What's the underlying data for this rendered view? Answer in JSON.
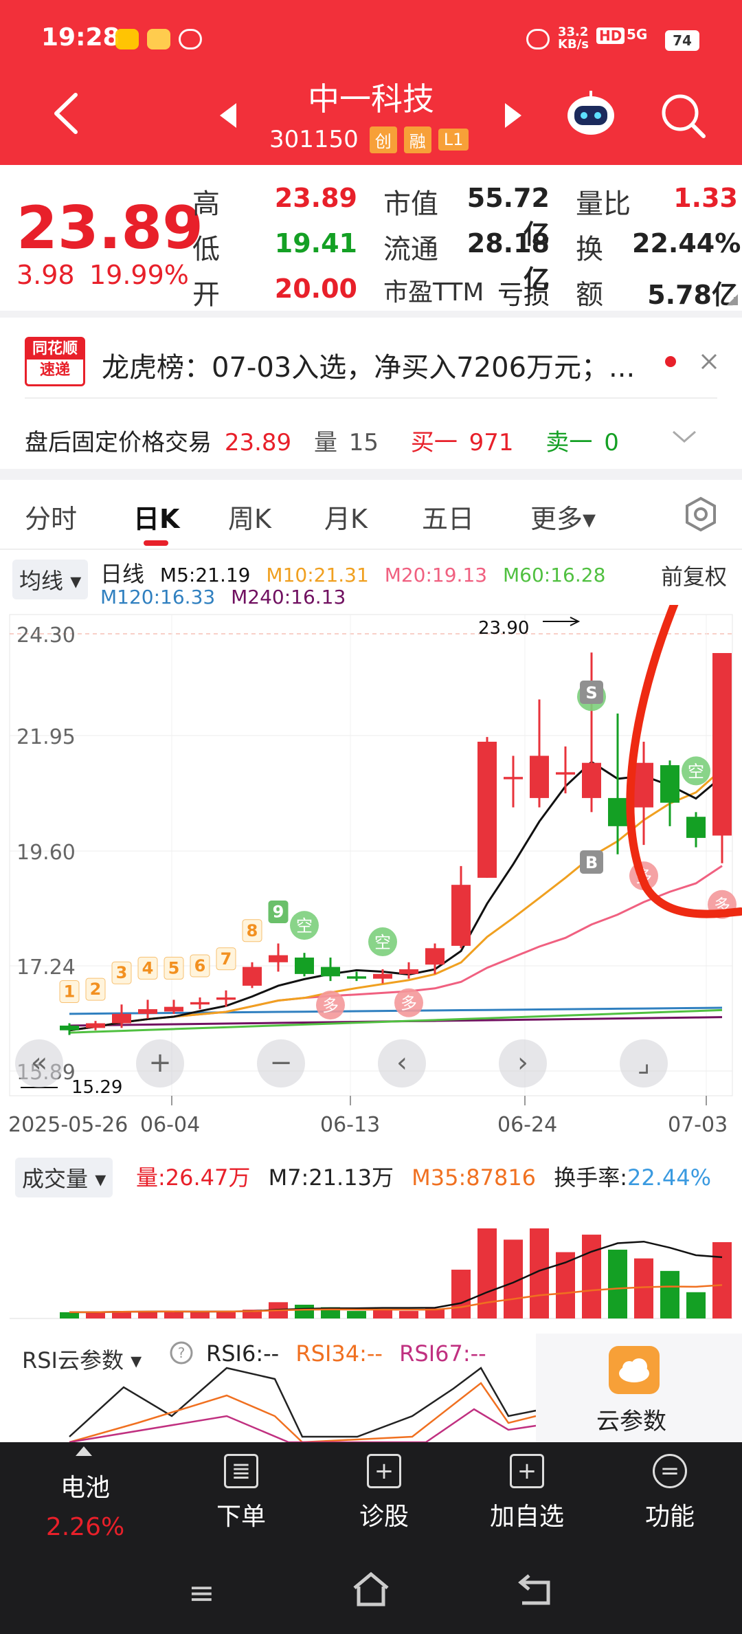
{
  "status_bar": {
    "time": "19:28",
    "net_speed": "33.2\nKB/s",
    "hd": "HD",
    "signal": "5G",
    "battery": "74"
  },
  "header": {
    "stock_name": "中一科技",
    "stock_code": "301150",
    "tags": [
      "创",
      "融",
      "L1"
    ]
  },
  "quote": {
    "price": "23.89",
    "change": "3.98",
    "change_pct": "19.99%",
    "col1": [
      {
        "label": "高",
        "value": "23.89",
        "color": "red"
      },
      {
        "label": "低",
        "value": "19.41",
        "color": "green"
      },
      {
        "label": "开",
        "value": "20.00",
        "color": "red"
      }
    ],
    "col2": [
      {
        "label": "市值",
        "value": "55.72亿"
      },
      {
        "label": "流通",
        "value": "28.18亿"
      },
      {
        "label": "市盈TTM",
        "value": "亏损"
      }
    ],
    "col3": [
      {
        "label": "量比",
        "value": "1.33",
        "color": "red"
      },
      {
        "label": "换",
        "value": "22.44%",
        "color": "dark"
      },
      {
        "label": "额",
        "value": "5.78亿",
        "color": "dark"
      }
    ]
  },
  "news": {
    "logo_top": "同花顺",
    "logo_bottom": "速递",
    "text": "龙虎榜：07-03入选，净买入7206万元；..."
  },
  "after_hours": {
    "label": "盘后固定价格交易",
    "price": "23.89",
    "vol_label": "量",
    "vol": "15",
    "buy_label": "买一",
    "buy": "971",
    "sell_label": "卖一",
    "sell": "0"
  },
  "tabs": [
    "分时",
    "日K",
    "周K",
    "月K",
    "五日",
    "更多▾"
  ],
  "active_tab": "日K",
  "kline": {
    "indicator_select": "均线",
    "period_label": "日线",
    "ma": [
      {
        "label": "M5:21.19",
        "color": "#111111"
      },
      {
        "label": "M10:21.31",
        "color": "#f0a020"
      },
      {
        "label": "M20:19.13",
        "color": "#f06080"
      },
      {
        "label": "M60:16.28",
        "color": "#50c040"
      },
      {
        "label": "M120:16.33",
        "color": "#3080c0"
      },
      {
        "label": "M240:16.13",
        "color": "#701060"
      }
    ],
    "adjust": "前复权",
    "price_axis": [
      "24.30",
      "21.95",
      "19.60",
      "17.24",
      "15.89"
    ],
    "max_annotation": "23.90",
    "min_annotation": "15.29",
    "date_axis": [
      "2025-05-26",
      "06-04",
      "06-13",
      "06-24",
      "07-03"
    ],
    "sequence_labels": [
      "1",
      "2",
      "3",
      "4",
      "5",
      "6",
      "7",
      "8",
      "9"
    ],
    "signal_labels": {
      "S": "S",
      "B": "B",
      "kong": "空",
      "duo": "多"
    }
  },
  "chart_data": {
    "type": "candlestick",
    "title": "",
    "ylim": [
      15.29,
      24.3
    ],
    "candles": [
      {
        "open": 15.95,
        "close": 15.85,
        "high": 16.0,
        "low": 15.75
      },
      {
        "open": 15.9,
        "close": 16.0,
        "high": 16.05,
        "low": 15.85
      },
      {
        "open": 16.0,
        "close": 16.2,
        "high": 16.4,
        "low": 15.9
      },
      {
        "open": 16.2,
        "close": 16.3,
        "high": 16.5,
        "low": 16.1
      },
      {
        "open": 16.25,
        "close": 16.35,
        "high": 16.5,
        "low": 16.2
      },
      {
        "open": 16.4,
        "close": 16.45,
        "high": 16.55,
        "low": 16.3
      },
      {
        "open": 16.5,
        "close": 16.55,
        "high": 16.7,
        "low": 16.35
      },
      {
        "open": 16.8,
        "close": 17.2,
        "high": 17.3,
        "low": 16.75
      },
      {
        "open": 17.3,
        "close": 17.45,
        "high": 17.7,
        "low": 17.1
      },
      {
        "open": 17.4,
        "close": 17.05,
        "high": 17.5,
        "low": 17.0
      },
      {
        "open": 17.2,
        "close": 17.0,
        "high": 17.4,
        "low": 16.9
      },
      {
        "open": 17.0,
        "close": 16.95,
        "high": 17.1,
        "low": 16.9
      },
      {
        "open": 16.95,
        "close": 17.05,
        "high": 17.15,
        "low": 16.85
      },
      {
        "open": 17.05,
        "close": 17.15,
        "high": 17.3,
        "low": 16.95
      },
      {
        "open": 17.25,
        "close": 17.6,
        "high": 17.7,
        "low": 17.05
      },
      {
        "open": 17.65,
        "close": 18.95,
        "high": 19.35,
        "low": 17.6
      },
      {
        "open": 19.1,
        "close": 22.0,
        "high": 22.1,
        "low": 19.1
      },
      {
        "open": 21.2,
        "close": 21.25,
        "high": 21.7,
        "low": 20.6
      },
      {
        "open": 20.8,
        "close": 21.7,
        "high": 22.9,
        "low": 20.6
      },
      {
        "open": 21.3,
        "close": 21.35,
        "high": 21.9,
        "low": 20.9
      },
      {
        "open": 20.8,
        "close": 21.55,
        "high": 23.9,
        "low": 20.5
      },
      {
        "open": 20.8,
        "close": 20.2,
        "high": 22.6,
        "low": 19.6
      },
      {
        "open": 20.6,
        "close": 21.55,
        "high": 22.0,
        "low": 19.8
      },
      {
        "open": 21.5,
        "close": 20.7,
        "high": 21.6,
        "low": 20.2
      },
      {
        "open": 20.4,
        "close": 19.95,
        "high": 20.5,
        "low": 19.75
      },
      {
        "open": 20.0,
        "close": 23.89,
        "high": 23.89,
        "low": 19.41
      }
    ],
    "volume": {
      "label": "成交量",
      "vol": "量:26.47万",
      "m7": "M7:21.13万",
      "m35": "M35:87816",
      "turnover_label": "换手率:",
      "turnover": "22.44%",
      "values": [
        0.05,
        0.05,
        0.06,
        0.06,
        0.06,
        0.05,
        0.06,
        0.07,
        0.13,
        0.11,
        0.09,
        0.06,
        0.07,
        0.06,
        0.08,
        0.39,
        0.72,
        0.63,
        0.72,
        0.53,
        0.67,
        0.55,
        0.48,
        0.38,
        0.21,
        0.61
      ]
    },
    "rsi": {
      "select": "RSI云参数",
      "rsi6": "RSI6:--",
      "rsi34": "RSI34:--",
      "rsi67": "RSI67:--",
      "cloud_label": "云参数"
    }
  },
  "footer": {
    "items": [
      {
        "label": "电池",
        "sub": "2.26%"
      },
      {
        "label": "下单"
      },
      {
        "label": "诊股"
      },
      {
        "label": "加自选"
      },
      {
        "label": "功能"
      }
    ]
  }
}
